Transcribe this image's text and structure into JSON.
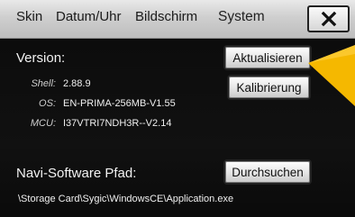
{
  "tabs": {
    "skin": "Skin",
    "datum_uhr": "Datum/Uhr",
    "bildschirm": "Bildschirm",
    "system": "System"
  },
  "close_icon": "close-icon",
  "version": {
    "heading": "Version:",
    "shell_key": "Shell:",
    "shell_value": "2.88.9",
    "os_key": "OS:",
    "os_value": "EN-PRIMA-256MB-V1.55",
    "mcu_key": "MCU:",
    "mcu_value": "I37VTRI7NDH3R--V2.14"
  },
  "buttons": {
    "aktualisieren": "Aktualisieren",
    "kalibrierung": "Kalibrierung",
    "durchsuchen": "Durchsuchen"
  },
  "navi": {
    "heading": "Navi-Software Pfad:",
    "path": "\\Storage Card\\Sygic\\WindowsCE\\Application.exe"
  },
  "colors": {
    "background": "#0b0b0b",
    "tabbar": "#cfcfcf",
    "pointer": "#f5b800"
  },
  "icons": {
    "pointer": "arrow-pointer-icon"
  }
}
